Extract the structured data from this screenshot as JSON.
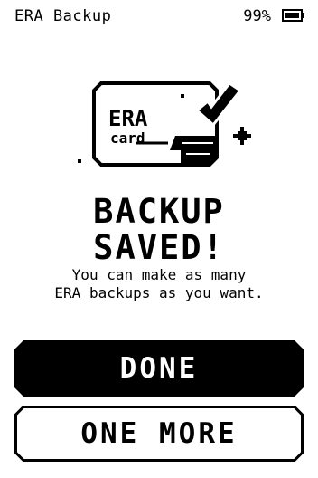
{
  "status": {
    "title": "ERA Backup",
    "battery": "99%"
  },
  "card": {
    "line1": "ERA",
    "line2": "card"
  },
  "headline": {
    "line1": "BACKUP",
    "line2": "SAVED!"
  },
  "message": {
    "line1": "You can make as many",
    "line2": "ERA backups as you want."
  },
  "buttons": {
    "done": "DONE",
    "one_more": "ONE MORE"
  }
}
